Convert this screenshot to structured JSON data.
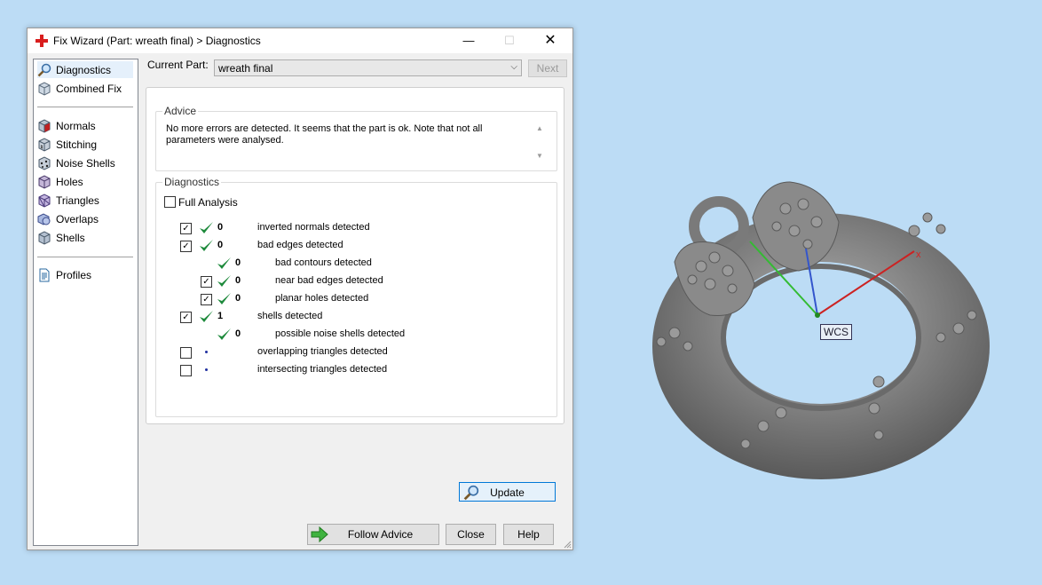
{
  "window": {
    "title": "Fix Wizard (Part: wreath final) > Diagnostics",
    "controls": {
      "minimize": "—",
      "maximize": "☐",
      "close": "✕"
    }
  },
  "sidebar": {
    "items": [
      {
        "label": "Diagnostics",
        "icon": "magnifier-icon",
        "selected": true
      },
      {
        "label": "Combined Fix",
        "icon": "cube-icon"
      },
      {
        "label": "Normals",
        "icon": "normals-cube-icon"
      },
      {
        "label": "Stitching",
        "icon": "stitching-cube-icon"
      },
      {
        "label": "Noise Shells",
        "icon": "noise-shells-cube-icon"
      },
      {
        "label": "Holes",
        "icon": "holes-cube-icon"
      },
      {
        "label": "Triangles",
        "icon": "triangles-cube-icon"
      },
      {
        "label": "Overlaps",
        "icon": "overlaps-icon"
      },
      {
        "label": "Shells",
        "icon": "shells-cube-icon"
      },
      {
        "label": "Profiles",
        "icon": "document-icon"
      }
    ]
  },
  "current_part": {
    "label": "Current Part:",
    "value": "wreath final"
  },
  "next_label": "Next",
  "advice": {
    "title": "Advice",
    "text": "No more errors are detected. It seems that the part is ok. Note that not all parameters were analysed."
  },
  "diagnostics": {
    "title": "Diagnostics",
    "full_analysis": {
      "label": "Full Analysis",
      "checked": false
    },
    "rows": [
      {
        "checked": true,
        "status": "check",
        "count": "0",
        "label": "inverted normals detected",
        "indent": 0,
        "has_checkbox": true
      },
      {
        "checked": true,
        "status": "check",
        "count": "0",
        "label": "bad edges detected",
        "indent": 0,
        "has_checkbox": true
      },
      {
        "checked": false,
        "status": "check",
        "count": "0",
        "label": "bad contours detected",
        "indent": 1,
        "has_checkbox": false
      },
      {
        "checked": true,
        "status": "check",
        "count": "0",
        "label": "near bad edges detected",
        "indent": 1,
        "has_checkbox": true
      },
      {
        "checked": true,
        "status": "check",
        "count": "0",
        "label": "planar holes detected",
        "indent": 1,
        "has_checkbox": true
      },
      {
        "checked": true,
        "status": "check",
        "count": "1",
        "label": "shells detected",
        "indent": 0,
        "has_checkbox": true
      },
      {
        "checked": false,
        "status": "check",
        "count": "0",
        "label": "possible noise shells detected",
        "indent": 1,
        "has_checkbox": false
      },
      {
        "checked": false,
        "status": "dot",
        "count": "",
        "label": "overlapping triangles detected",
        "indent": 0,
        "has_checkbox": true
      },
      {
        "checked": false,
        "status": "dot",
        "count": "",
        "label": "intersecting triangles detected",
        "indent": 0,
        "has_checkbox": true
      }
    ],
    "update_label": "Update"
  },
  "footer": {
    "follow_advice": "Follow Advice",
    "close": "Close",
    "help": "Help"
  },
  "viewport": {
    "wcs_label": "WCS",
    "x_axis_label": "x"
  },
  "colors": {
    "check_green": "#1e8a3c",
    "accent_blue": "#0078d7",
    "background": "#bcdcf5",
    "model_gray": "#8a8a8a"
  }
}
